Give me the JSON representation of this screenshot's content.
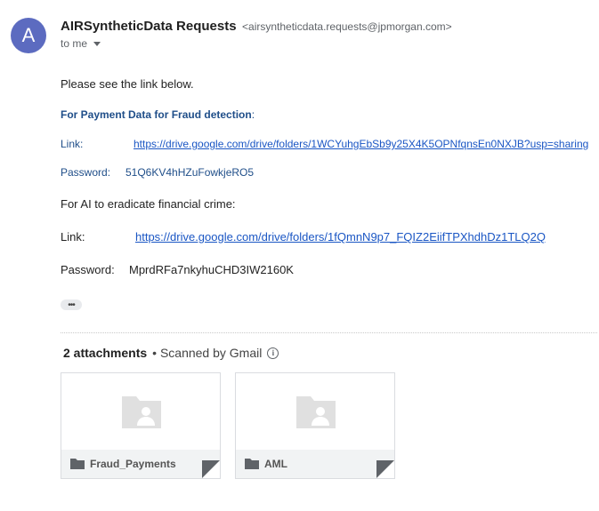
{
  "sender": {
    "avatar_letter": "A",
    "name": "AIRSyntheticData Requests",
    "email": "<airsyntheticdata.requests@jpmorgan.com>",
    "recipient": "to me",
    "avatar_color": "#5c6bc0"
  },
  "body": {
    "intro": "Please see the link below.",
    "section1": {
      "heading": "For Payment Data for Fraud detection",
      "heading_suffix": ":",
      "link_label": "Link:",
      "link_url": "https://drive.google.com/drive/folders/1WCYuhgEbSb9y25X4K5OPNfqnsEn0NXJB?usp=sharing",
      "password_label": "Password:",
      "password_value": "51Q6KV4hHZuFowkjeRO5"
    },
    "section2": {
      "heading": "For AI to eradicate financial crime:",
      "link_label": "Link:",
      "link_url": "https://drive.google.com/drive/folders/1fQmnN9p7_FQIZ2EiifTPXhdhDz1TLQ2Q",
      "password_label": "Password:",
      "password_value": "MprdRFa7nkyhuCHD3IW2160K"
    },
    "more_label": "•••"
  },
  "attachments": {
    "count_label": "2 attachments",
    "scan_label": "• Scanned by Gmail",
    "items": [
      {
        "name": "Fraud_Payments",
        "icon": "folder-icon"
      },
      {
        "name": "AML",
        "icon": "folder-icon"
      }
    ]
  },
  "colors": {
    "link": "#1a56c4",
    "blue_text": "#1f4e89"
  }
}
